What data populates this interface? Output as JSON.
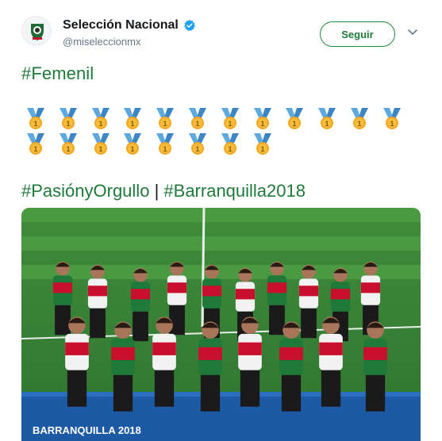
{
  "account": {
    "display_name": "Selección Nacional",
    "handle": "@miseleccionmx",
    "verified": true
  },
  "actions": {
    "follow_label": "Seguir",
    "menu_icon": "chevron-down-icon"
  },
  "tweet": {
    "line1": "#Femenil",
    "medal_icon": "sports-medal-emoji",
    "medal_count_row1": 12,
    "medal_count_row2": 8,
    "tag_passion": "#PasiónyOrgullo",
    "separator": "|",
    "tag_city": "#Barranquilla2018"
  },
  "photo": {
    "podium_text": "BARRANQUILLA 2018"
  },
  "colors": {
    "brand_green": "#1f7a3a",
    "verified_blue": "#1da1f2",
    "ribbon_blue": "#5ea9dd",
    "medal_gold": "#f4a623"
  }
}
